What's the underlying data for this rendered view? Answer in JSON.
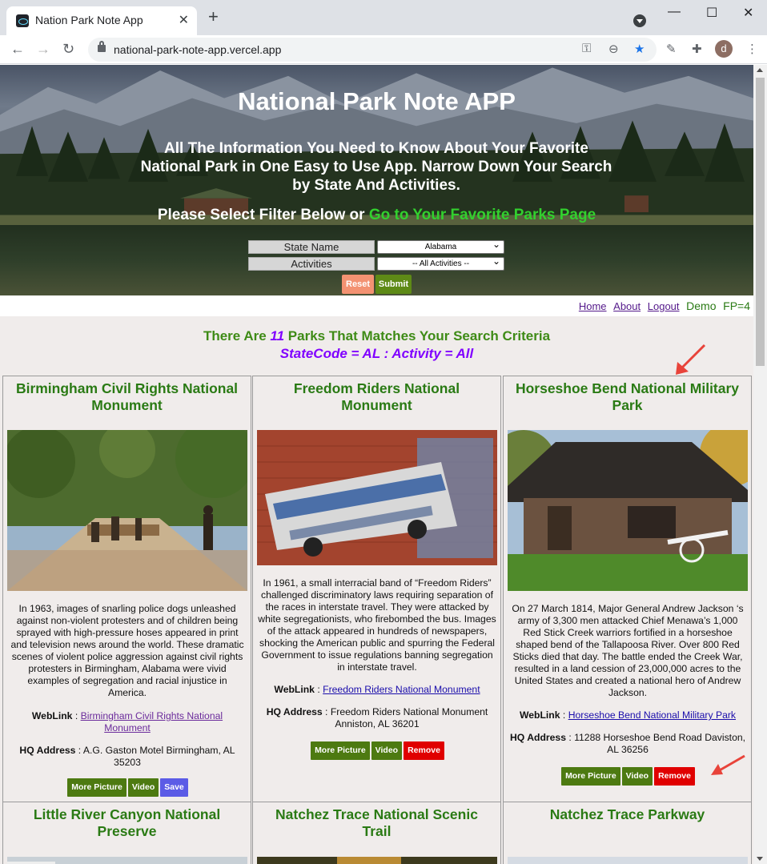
{
  "browser": {
    "tab_title": "Nation Park Note App",
    "url": "national-park-note-app.vercel.app",
    "profile_initial": "d"
  },
  "hero": {
    "title": "National Park Note APP",
    "tagline": "All The Information You Need to Know About Your Favorite National Park in One Easy to Use App. Narrow Down Your Search by State And Activities.",
    "select_prefix": "Please Select Filter Below or ",
    "favorites_link": "Go to Your Favorite Parks Page",
    "state_label": "State Name",
    "state_value": "Alabama",
    "activities_label": "Activities",
    "activities_value": "-- All Activities --",
    "reset_label": "Reset",
    "submit_label": "Submit"
  },
  "nav": {
    "home": "Home",
    "about": "About",
    "logout": "Logout",
    "user": "Demo",
    "fp": "FP=4"
  },
  "results": {
    "prefix": "There Are ",
    "count": "11",
    "suffix": " Parks That Matches Your Search Criteria",
    "criteria": "StateCode = AL : Activity = All"
  },
  "parks": [
    {
      "name": "Birmingham Civil Rights National Monument",
      "description": "In 1963, images of snarling police dogs unleashed against non-violent protesters and of children being sprayed with high-pressure hoses appeared in print and television news around the world. These dramatic scenes of violent police aggression against civil rights protesters in Birmingham, Alabama were vivid examples of segregation and racial injustice in America.",
      "weblink_label": "WebLink",
      "weblink": "Birmingham Civil Rights National Monument",
      "hq_label": "HQ Address",
      "hq": "A.G. Gaston Motel Birmingham, AL 35203",
      "buttons": [
        "More Picture",
        "Video",
        "Save"
      ]
    },
    {
      "name": "Freedom Riders National Monument",
      "description": "In 1961, a small interracial band of “Freedom Riders” challenged discriminatory laws requiring separation of the races in interstate travel. They were attacked by white segregationists, who firebombed the bus. Images of the attack appeared in hundreds of newspapers, shocking the American public and spurring the Federal Government to issue regulations banning segregation in interstate travel.",
      "weblink_label": "WebLink",
      "weblink": "Freedom Riders National Monument",
      "hq_label": "HQ Address",
      "hq": "Freedom Riders National Monument Anniston, AL 36201",
      "buttons": [
        "More Picture",
        "Video",
        "Remove"
      ]
    },
    {
      "name": "Horseshoe Bend National Military Park",
      "description": "On 27 March 1814, Major General Andrew Jackson ‘s army of 3,300 men attacked Chief Menawa’s 1,000 Red Stick Creek warriors fortified in a horseshoe shaped bend of the Tallapoosa River. Over 800 Red Sticks died that day. The battle ended the Creek War, resulted in a land cession of 23,000,000 acres to the United States and created a national hero of Andrew Jackson.",
      "weblink_label": "WebLink",
      "weblink": "Horseshoe Bend National Military Park",
      "hq_label": "HQ Address",
      "hq": "11288 Horseshoe Bend Road Daviston, AL 36256",
      "buttons": [
        "More Picture",
        "Video",
        "Remove"
      ]
    },
    {
      "name": "Little River Canyon National Preserve"
    },
    {
      "name": "Natchez Trace National Scenic Trail"
    },
    {
      "name": "Natchez Trace Parkway"
    }
  ],
  "colors": {
    "park_title": "#2a7a14",
    "accent_purple": "#8000ff",
    "button_green": "#4d7a11",
    "button_red": "#e00000",
    "button_blue": "#5b5be6",
    "favorites_link": "#32d02e",
    "annotation_arrow": "#e8433a"
  }
}
